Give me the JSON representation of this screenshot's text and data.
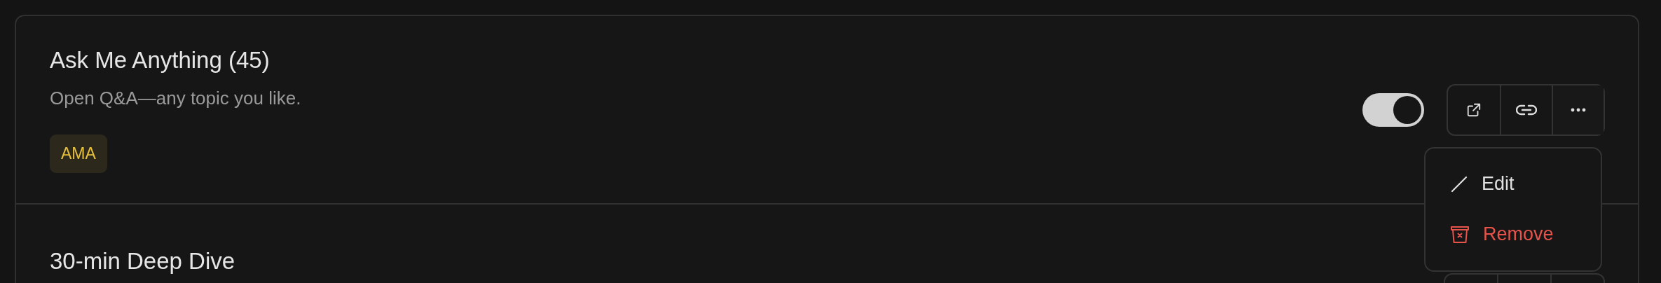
{
  "rows": [
    {
      "title": "Ask Me Anything (45)",
      "description": "Open Q&A—any topic you like.",
      "tag": "AMA",
      "toggle": {
        "on": true
      },
      "menu_open": true,
      "menu": [
        {
          "label": "Edit",
          "kind": "edit"
        },
        {
          "label": "Remove",
          "kind": "danger"
        }
      ]
    },
    {
      "title": "30-min Deep Dive"
    }
  ]
}
